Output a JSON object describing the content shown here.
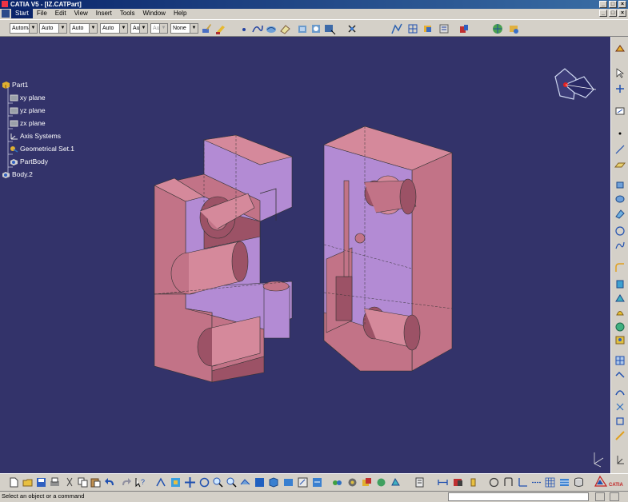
{
  "window": {
    "title": "CATIA V5 - [IZ.CATPart]"
  },
  "menu": {
    "items": [
      "Start",
      "File",
      "Edit",
      "View",
      "Insert",
      "Tools",
      "Window",
      "Help"
    ]
  },
  "toolbar": {
    "combos": [
      "Automa",
      "Auto",
      "Auto",
      "Auto",
      "Aut",
      "Aut",
      "None"
    ]
  },
  "tree": {
    "root": "Part1",
    "items": [
      "xy plane",
      "yz plane",
      "zx plane",
      "Axis Systems",
      "Geometrical Set.1",
      "PartBody",
      "Body.2"
    ]
  },
  "status": {
    "message": "Select an object or a command",
    "command_value": ""
  },
  "brand": {
    "logo_text": "CATIA"
  },
  "colors": {
    "viewport_bg": "#33336a",
    "part_face": "#c27387",
    "part_top": "#d5899b",
    "part_side_lilac": "#b38bd4",
    "part_dark": "#9c5266",
    "titlebar": "#0a246a"
  },
  "icons": {
    "right_toolbar": [
      "sketcher-icon",
      "select-arrow-icon",
      "transform-icon",
      "sketch-plane-icon",
      "point-icon",
      "line-icon",
      "plane-icon",
      "extrude-icon",
      "revolve-icon",
      "sphere-icon",
      "circle-icon",
      "spline-icon",
      "fillet-icon",
      "pad-icon",
      "pocket-icon",
      "shaft-icon",
      "groove-icon",
      "hole-icon",
      "rib-icon",
      "stiffener-icon",
      "boolean-icon",
      "draft-icon",
      "shell-icon",
      "thickness-icon",
      "mirror-icon",
      "pattern-icon",
      "compass-icon"
    ],
    "bottom_toolbar": [
      "new-icon",
      "open-icon",
      "save-icon",
      "print-icon",
      "cut-icon",
      "copy-icon",
      "paste-icon",
      "undo-icon",
      "redo-icon",
      "whatsthis-icon",
      "fly-mode-icon",
      "fit-all-icon",
      "pan-icon",
      "rotate-icon",
      "zoom-in-icon",
      "zoom-out-icon",
      "normal-view-icon",
      "iso-view-icon",
      "shading-icon",
      "hide-show-icon",
      "swap-visible-icon",
      "measure-icon",
      "analysis-icon",
      "render-icon",
      "material-icon",
      "apply-material-icon",
      "update-icon",
      "axis-icon",
      "constraints-icon",
      "knowledge-icon",
      "publication-icon",
      "sketch-icon",
      "grid-icon",
      "table-icon",
      "snap-icon",
      "catia-logo"
    ]
  }
}
